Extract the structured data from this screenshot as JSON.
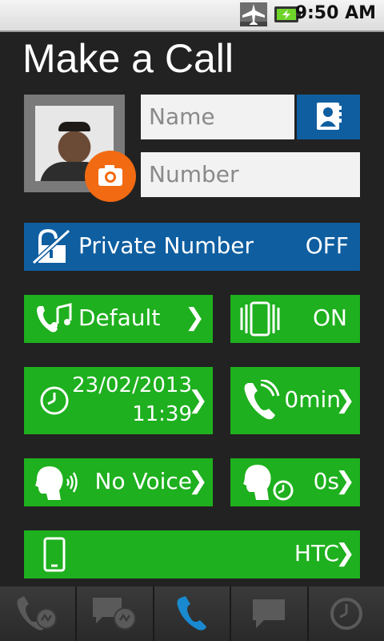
{
  "status_bar": {
    "time": "9:50 AM"
  },
  "title": "Make a Call",
  "contact": {
    "name_placeholder": "Name",
    "number_placeholder": "Number"
  },
  "private_number": {
    "label": "Private Number",
    "value": "OFF"
  },
  "ringtone": {
    "label": "Default",
    "chevron": "❯"
  },
  "vibrate": {
    "value": "ON"
  },
  "schedule": {
    "date": "23/02/2013",
    "time": "11:39",
    "chevron": "❯"
  },
  "call_duration": {
    "value": "0min",
    "chevron": "❯"
  },
  "voice": {
    "label": "No Voice",
    "chevron": "❯"
  },
  "delay": {
    "value": "0s",
    "chevron": "❯"
  },
  "device": {
    "value": "HTC",
    "chevron": "❯"
  },
  "colors": {
    "green": "#1eb01e",
    "blue": "#0f5ea0",
    "orange": "#f26a12",
    "background": "#222222"
  },
  "bottom_nav": [
    {
      "icon": "call-log-icon"
    },
    {
      "icon": "messages-log-icon"
    },
    {
      "icon": "phone-icon"
    },
    {
      "icon": "message-icon"
    },
    {
      "icon": "scheduled-icon"
    }
  ]
}
